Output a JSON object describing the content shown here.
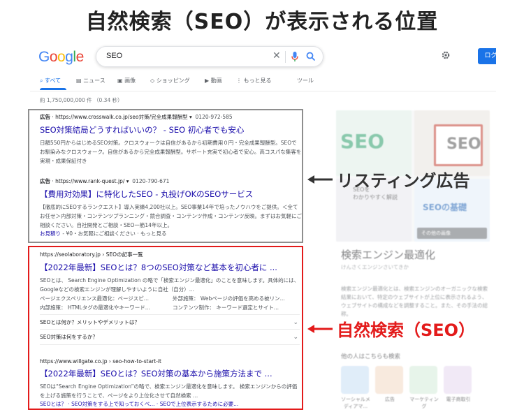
{
  "headline": "自然検索（SEO）が表示される位置",
  "google": {
    "logo": {
      "l1": "G",
      "l2": "o",
      "l3": "o",
      "l4": "g",
      "l5": "l",
      "l6": "e"
    },
    "query": "SEO",
    "login_label": "ログイン",
    "tabs": [
      "すべて",
      "ニュース",
      "画像",
      "ショッピング",
      "動画",
      "もっと見る",
      "ツール"
    ],
    "stats": "約 1,750,000,000 件 （0.34 秒）"
  },
  "ads": [
    {
      "label": "広告",
      "url": "https://www.crosswalk.co.jp/seo対策/完全成果報酬型",
      "phone": "0120-972-585",
      "title": "SEO対策結局どうすればいいの？ - SEO 初心者でも安心",
      "snippet": "日額550円からはじめるSEO対策。クロスウォークは自信があるから初期費用０円・完全成果報酬型。SEOでお馴染みなクロスウォーク。自信があるから完全成果報酬型。サポート充実で初心者で安心。高コスパな集客を実現・成果保証付き"
    },
    {
      "label": "広告",
      "url": "https://www.rank-quest.jp/",
      "phone": "0120-790-671",
      "title": "【費用対効果】に特化したSEO - 丸投げOKのSEOサービス",
      "snippet": "【徹底的にSEOするランクエスト】導入実績4,200社以上。SEO事業14年で培ったノウハウをご提供。＜全てお任せ＞内部対策・コンテンツプランニング・競合調査・コンテンツ作成・コンテンツ反映。まずはお気軽にご相談ください。自社開発とご相談・SEO一筋14年以上。",
      "links": {
        "l1": "お見積り",
        "l2": "- ¥0・お気軽にご相談ください",
        "l3": "· もっと見る"
      }
    }
  ],
  "organic": [
    {
      "url": "https://seolaboratory.jp › SEOの記事一覧",
      "title": "【2022年最新】SEOとは？8つのSEO対策など基本を初心者に ...",
      "snippet": "SEOとは、 Search Engine Optimization の略で「検索エンジン最適化」のことを意味します。具体的には、Googleなどの検索エンジンが理解しやすいように自社（自分）...",
      "sub": [
        {
          "a": "ページエクスペリエンス最適化：ページスピ...",
          "b": "外部施策： Webページの評価を高める被リン..."
        },
        {
          "a": "内部施策： HTMLタグの最適化やキーワード...",
          "b": "コンテンツ制作： キーワード選定とサイト..."
        }
      ],
      "questions": [
        "SEOとは何か？メリットやデメリットは？",
        "SEO対策は何をするか？"
      ]
    },
    {
      "url": "https://www.willgate.co.jp › seo-how-to-start-it",
      "title": "【2022年最新】SEOとは？SEO対策の基本から施策方法まで ...",
      "snippet": "SEOは“Search Engine Optimization”の略で、検索エンジン最適化を意味します。 検索エンジンからの評価を上げる施策を行うことで、ページをより上位化させて自然検索 ...",
      "links": {
        "l1": "SEOとは？",
        "l2": "· SEO対策をする上で知っておくべ...",
        "l3": "· SEOで上位表示するために必要..."
      }
    }
  ],
  "knowledge_panel": {
    "image_label": "その他の画像",
    "badge": "SEO",
    "tile_text": "SEOの基礎",
    "tile_text2": "SEOを\nわかりやすく解説",
    "title": "検索エンジン最適化",
    "subtitle": "けんさくエンジンさいてきか",
    "text": "検索エンジン最適化とは、検索エンジンのオーガニックな検索結果において、特定のウェブサイトが上位に表示されるよう、ウェブサイトの構成などを調整すること。また、その手法の総称。",
    "also_label": "他の人はこちらも検索",
    "categories": [
      "ソーシャルメディアマ...",
      "広告",
      "マーケティング",
      "電子商取引"
    ]
  },
  "callouts": {
    "listing": "リスティング広告",
    "organic": "自然検索（SEO）"
  },
  "colors": {
    "link": "#1a0dab",
    "google_blue": "#1a73e8",
    "highlight_red": "#e31b1b",
    "box_gray": "#8e8e8e"
  }
}
